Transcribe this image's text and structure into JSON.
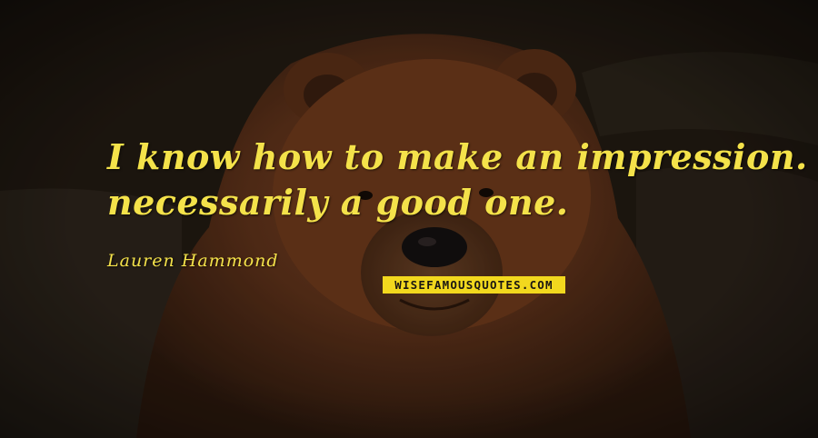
{
  "quote": {
    "line1": "I know how to make an impression. Not",
    "line2": "necessarily a good one."
  },
  "author": "Lauren Hammond",
  "watermark": "WISEFAMOUSQUOTES.COM",
  "colors": {
    "text": "#f4e24a",
    "watermark_bg": "#f2d81e",
    "background": "#1e1710",
    "fur": "#6b3a1c"
  }
}
